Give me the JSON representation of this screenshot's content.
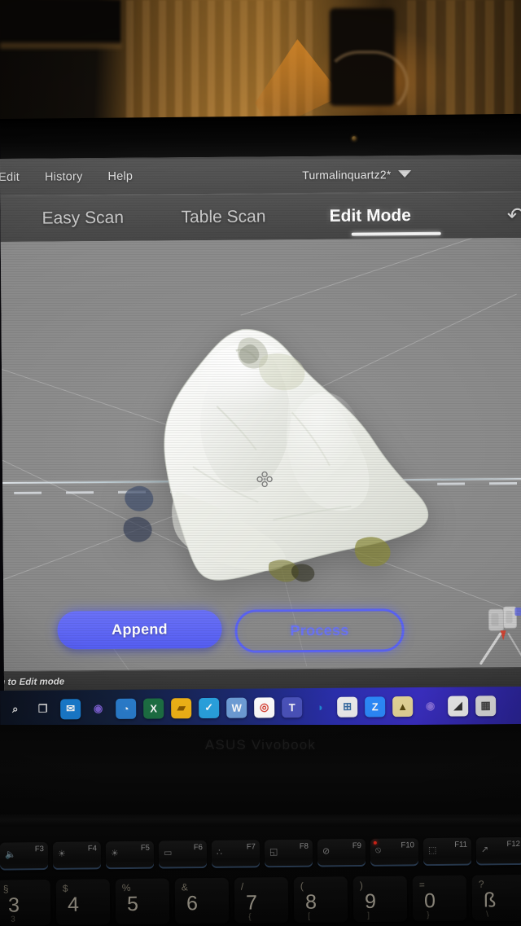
{
  "app": {
    "window_title": "Turmalinquartz2*",
    "menubar": {
      "items": [
        {
          "label": "Edit",
          "name": "menu-edit"
        },
        {
          "label": "History",
          "name": "menu-history"
        },
        {
          "label": "Help",
          "name": "menu-help"
        }
      ],
      "project_name": "Turmalinquartz2*",
      "project_caret_icon": "chevron-down-icon"
    },
    "tabs": [
      {
        "label": "Easy Scan",
        "active": false
      },
      {
        "label": "Table Scan",
        "active": false
      },
      {
        "label": "Edit Mode",
        "active": true
      }
    ],
    "undo_icon": "undo-arrow-icon",
    "viewport": {
      "model_description": "scanned white quartz mineral",
      "pivot_icon": "pivot-gizmo-icon",
      "nav_gizmo_icon": "axis-navigation-gizmo-icon"
    },
    "actions": {
      "append_label": "Append",
      "process_label": "Process"
    },
    "statusbar": {
      "text": "tch to Edit mode"
    },
    "colors": {
      "accent_blue": "#5b64f2",
      "accent_blue_light": "#6b72f8",
      "viewport_gray": "#8a8a8a",
      "chrome_gray": "#474747",
      "statusbar_gray": "#3a3a3a",
      "tab_active_text": "#ffffff",
      "tab_inactive_text": "#c8c8c8"
    }
  },
  "taskbar": {
    "icons": [
      {
        "name": "search-icon",
        "glyph": "⌕",
        "bg": "transparent",
        "fg": "#e8e8e8"
      },
      {
        "name": "task-view-icon",
        "glyph": "❐",
        "bg": "transparent",
        "fg": "#d8d8d8"
      },
      {
        "name": "mail-icon",
        "glyph": "✉",
        "bg": "#1a7fd4",
        "fg": "#ffffff"
      },
      {
        "name": "browser-icon",
        "glyph": "◉",
        "bg": "transparent",
        "fg": "#7b5fd0"
      },
      {
        "name": "photos-icon",
        "glyph": "◔",
        "bg": "#2b7fd0",
        "fg": "#ffffff"
      },
      {
        "name": "excel-icon",
        "glyph": "X",
        "bg": "#1d7044",
        "fg": "#ffffff"
      },
      {
        "name": "file-explorer-icon",
        "glyph": "▰",
        "bg": "#f2b417",
        "fg": "#8a5a00"
      },
      {
        "name": "telegram-icon",
        "glyph": "✓",
        "bg": "#2aa3e0",
        "fg": "#ffffff"
      },
      {
        "name": "word-icon",
        "glyph": "W",
        "bg": "#6f9fd8",
        "fg": "#ffffff"
      },
      {
        "name": "chrome-icon",
        "glyph": "◎",
        "bg": "#ffffff",
        "fg": "#d94235"
      },
      {
        "name": "teams-icon",
        "glyph": "T",
        "bg": "#4b53bc",
        "fg": "#ffffff"
      },
      {
        "name": "edge-icon",
        "glyph": "◑",
        "bg": "transparent",
        "fg": "#1e8ad6"
      },
      {
        "name": "store-icon",
        "glyph": "⊞",
        "bg": "#f0f0f0",
        "fg": "#3a6ea5"
      },
      {
        "name": "zoom-icon",
        "glyph": "Z",
        "bg": "#2d8cff",
        "fg": "#ffffff"
      },
      {
        "name": "scanner-app-icon",
        "glyph": "▲",
        "bg": "#e8d89a",
        "fg": "#5a4a10"
      },
      {
        "name": "browser-alt-icon",
        "glyph": "◉",
        "bg": "transparent",
        "fg": "#8a72dd"
      },
      {
        "name": "image-editor-icon",
        "glyph": "◢",
        "bg": "#efefef",
        "fg": "#333333"
      },
      {
        "name": "notes-icon",
        "glyph": "▦",
        "bg": "#dcdcdc",
        "fg": "#444444"
      }
    ]
  },
  "hardware": {
    "brand": "ASUS Vivobook",
    "function_keys": [
      {
        "label": "F3",
        "glyph": "🔈",
        "recording_dot": false
      },
      {
        "label": "F4",
        "glyph": "☀",
        "recording_dot": false
      },
      {
        "label": "F5",
        "glyph": "☀",
        "recording_dot": false
      },
      {
        "label": "F6",
        "glyph": "▭",
        "recording_dot": false
      },
      {
        "label": "F7",
        "glyph": "∴",
        "recording_dot": false
      },
      {
        "label": "F8",
        "glyph": "◱",
        "recording_dot": false
      },
      {
        "label": "F9",
        "glyph": "⊘",
        "recording_dot": false
      },
      {
        "label": "F10",
        "glyph": "⦸",
        "recording_dot": true
      },
      {
        "label": "F11",
        "glyph": "⬚",
        "recording_dot": false
      },
      {
        "label": "F12",
        "glyph": "↗",
        "recording_dot": false
      }
    ],
    "number_keys": [
      {
        "upper": "§",
        "digit": "3",
        "lower": "3"
      },
      {
        "upper": "$",
        "digit": "4",
        "lower": ""
      },
      {
        "upper": "%",
        "digit": "5",
        "lower": ""
      },
      {
        "upper": "&",
        "digit": "6",
        "lower": ""
      },
      {
        "upper": "/",
        "digit": "7",
        "lower": "{"
      },
      {
        "upper": "(",
        "digit": "8",
        "lower": "["
      },
      {
        "upper": ")",
        "digit": "9",
        "lower": "]"
      },
      {
        "upper": "=",
        "digit": "0",
        "lower": "}"
      },
      {
        "upper": "?",
        "digit": "ß",
        "lower": "\\"
      }
    ]
  }
}
